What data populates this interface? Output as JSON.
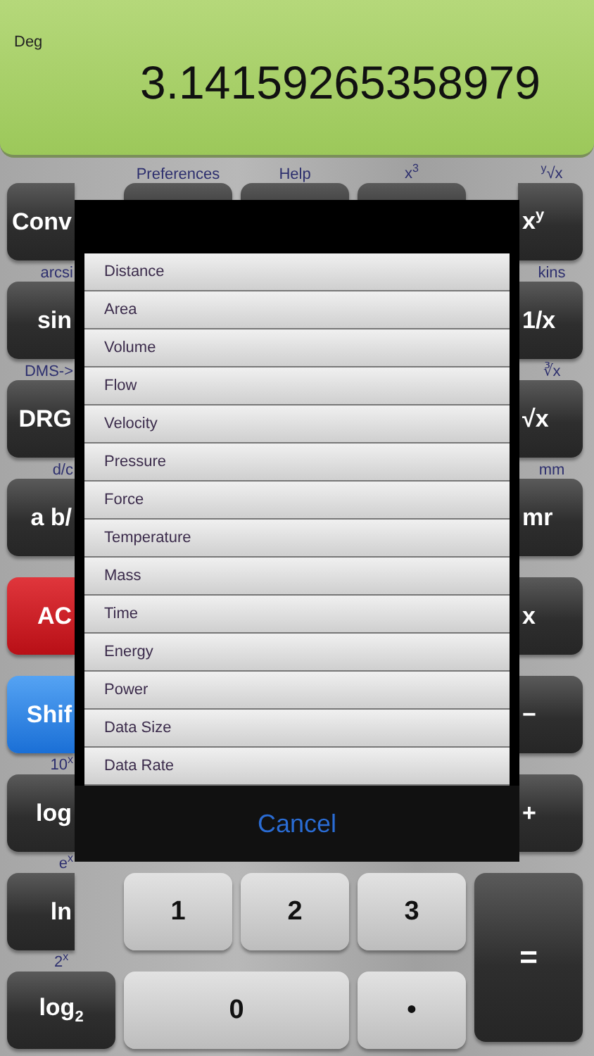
{
  "display": {
    "mode": "Deg",
    "value": "3.14159265358979"
  },
  "keypad": [
    {
      "keys": [
        {
          "kind": "dark",
          "label": "Conv",
          "cut_right": true
        },
        {
          "kind": "dark",
          "caption": "Preferences"
        },
        {
          "kind": "dark",
          "caption": "Help"
        },
        {
          "kind": "dark",
          "caption": "x$^{3}$"
        },
        {
          "kind": "dark",
          "label": "x$^{y}$",
          "caption": "$^{y}$√x",
          "cut_left": true
        }
      ]
    },
    {
      "keys": [
        {
          "kind": "dark",
          "label": "sin",
          "caption": "arcsi",
          "cut_right": true
        },
        {
          "kind": "covered"
        },
        {
          "kind": "covered"
        },
        {
          "kind": "covered"
        },
        {
          "kind": "dark",
          "label": "1/x",
          "caption": "kins",
          "cut_left": true
        }
      ]
    },
    {
      "keys": [
        {
          "kind": "dark",
          "label": "DRG",
          "caption": "DMS->",
          "cut_right": true
        },
        {
          "kind": "covered"
        },
        {
          "kind": "covered"
        },
        {
          "kind": "covered"
        },
        {
          "kind": "dark",
          "label": "√x",
          "caption": "∛x",
          "cut_left": true
        }
      ]
    },
    {
      "keys": [
        {
          "kind": "dark",
          "label": "a b/",
          "caption": "d/c",
          "cut_right": true
        },
        {
          "kind": "covered"
        },
        {
          "kind": "covered"
        },
        {
          "kind": "covered"
        },
        {
          "kind": "dark",
          "label": "mr",
          "caption": "mm",
          "cut_left": true
        }
      ]
    },
    {
      "keys": [
        {
          "kind": "red",
          "label": "AC",
          "cut_right": true
        },
        {
          "kind": "covered"
        },
        {
          "kind": "covered"
        },
        {
          "kind": "covered"
        },
        {
          "kind": "dark",
          "label": "x",
          "cut_left": true
        }
      ]
    },
    {
      "keys": [
        {
          "kind": "blue",
          "label": "Shif",
          "cut_right": true
        },
        {
          "kind": "covered"
        },
        {
          "kind": "covered"
        },
        {
          "kind": "covered"
        },
        {
          "kind": "dark",
          "label": "−",
          "cut_left": true
        }
      ]
    },
    {
      "keys": [
        {
          "kind": "dark",
          "label": "log",
          "caption": "10$^{x}$",
          "cut_right": true
        },
        {
          "kind": "covered"
        },
        {
          "kind": "covered"
        },
        {
          "kind": "covered"
        },
        {
          "kind": "dark",
          "label": "+",
          "cut_left": true
        }
      ]
    },
    {
      "keys": [
        {
          "kind": "dark",
          "label": "ln",
          "caption": "e$^{x}$",
          "cut_right": true
        },
        {
          "kind": "light",
          "label": "1"
        },
        {
          "kind": "light",
          "label": "2"
        },
        {
          "kind": "light",
          "label": "3"
        },
        {
          "kind": "dark",
          "label": "=",
          "tall": true
        }
      ]
    },
    {
      "keys": [
        {
          "kind": "dark",
          "label": "log$_{2}$",
          "caption": "2$^{x}$"
        },
        {
          "kind": "light",
          "label": "0",
          "wide": true
        },
        {
          "kind": "light",
          "label": "•"
        }
      ]
    }
  ],
  "picker": {
    "items": [
      "Distance",
      "Area",
      "Volume",
      "Flow",
      "Velocity",
      "Pressure",
      "Force",
      "Temperature",
      "Mass",
      "Time",
      "Energy",
      "Power",
      "Data Size",
      "Data Rate"
    ],
    "cancel": "Cancel"
  }
}
